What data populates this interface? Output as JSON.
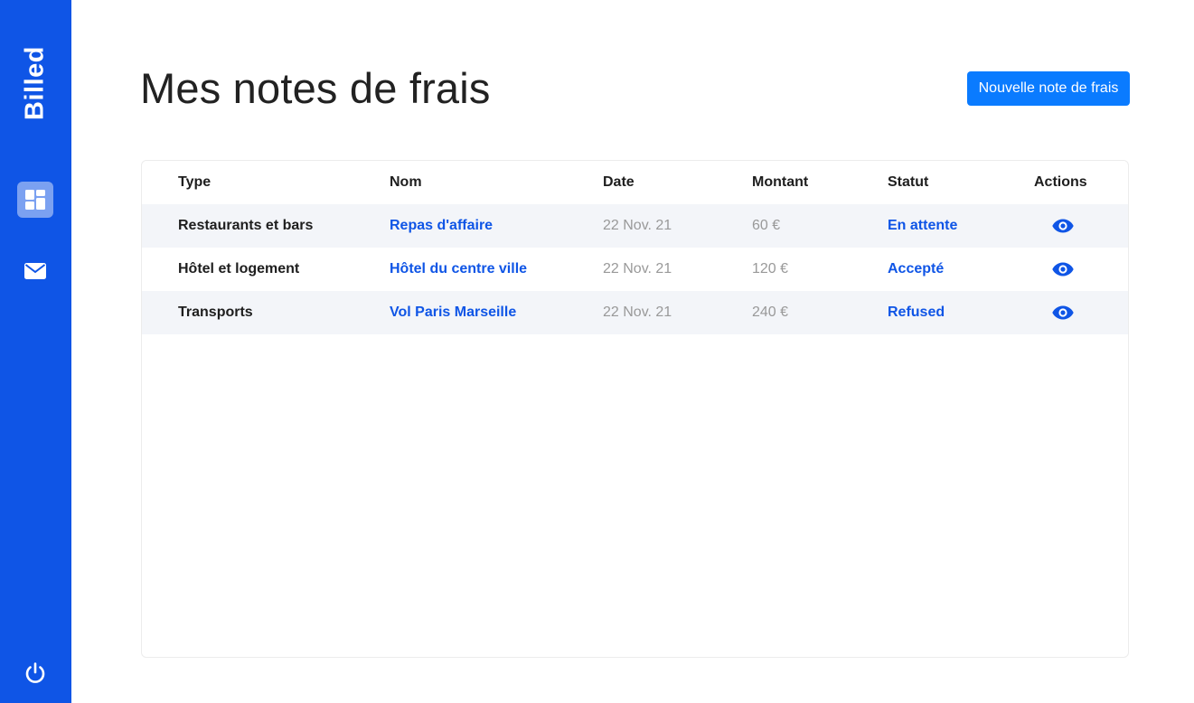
{
  "sidebar": {
    "brand": "Billed",
    "nav": [
      {
        "id": "dashboard",
        "icon": "dashboard-icon",
        "active": true
      },
      {
        "id": "mail",
        "icon": "mail-icon",
        "active": false
      }
    ],
    "logout_icon": "power-icon"
  },
  "header": {
    "title": "Mes notes de frais",
    "new_bill_label": "Nouvelle note de frais"
  },
  "table": {
    "columns": [
      "Type",
      "Nom",
      "Date",
      "Montant",
      "Statut",
      "Actions"
    ],
    "rows": [
      {
        "type": "Restaurants et bars",
        "nom": "Repas d'affaire",
        "date": "22 Nov. 21",
        "montant": "60 €",
        "statut": "En attente",
        "action_icon": "eye-icon"
      },
      {
        "type": "Hôtel et logement",
        "nom": "Hôtel du centre ville",
        "date": "22 Nov. 21",
        "montant": "120 €",
        "statut": "Accepté",
        "action_icon": "eye-icon"
      },
      {
        "type": "Transports",
        "nom": "Vol Paris Marseille",
        "date": "22 Nov. 21",
        "montant": "240 €",
        "statut": "Refused",
        "action_icon": "eye-icon"
      }
    ]
  },
  "colors": {
    "sidebar": "#0f55e6",
    "primary_button": "#0a7bff",
    "link": "#0f55e6",
    "row_alt": "#f3f5f9",
    "muted_text": "#999999"
  }
}
